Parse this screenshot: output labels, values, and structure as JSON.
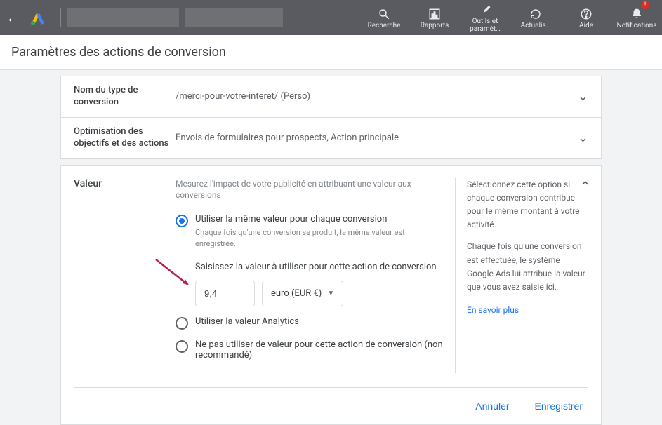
{
  "topbar": {
    "icons": [
      {
        "glyph": "search",
        "label": "Recherche"
      },
      {
        "glyph": "report",
        "label": "Rapports"
      },
      {
        "glyph": "tools",
        "label": "Outils et paramèt…"
      },
      {
        "glyph": "refresh",
        "label": "Actualis…"
      },
      {
        "glyph": "help",
        "label": "Aide"
      },
      {
        "glyph": "bell",
        "label": "Notifications"
      }
    ]
  },
  "page_title": "Paramètres des actions de conversion",
  "settings": {
    "name": {
      "label": "Nom du type de conversion",
      "value": "/merci-pour-votre-interet/ (Perso)"
    },
    "optim": {
      "label": "Optimisation des objectifs et des actions",
      "value": "Envois de formulaires pour prospects, Action principale"
    }
  },
  "valeur": {
    "label": "Valeur",
    "subtitle": "Mesurez l'impact de votre publicité en attribuant une valeur aux conversions",
    "option1": {
      "title": "Utiliser la même valeur pour chaque conversion",
      "desc": "Chaque fois qu'une conversion se produit, la même valeur est enregistrée.",
      "input_label": "Saisissez la valeur à utiliser pour cette action de conversion",
      "value": "9,4",
      "currency": "euro (EUR €)"
    },
    "option2": {
      "title": "Utiliser la valeur Analytics"
    },
    "option3": {
      "title": "Ne pas utiliser de valeur pour cette action de conversion (non recommandé)"
    },
    "help": {
      "p1": "Sélectionnez cette option si chaque conversion contribue pour le même montant à votre activité.",
      "p2": "Chaque fois qu'une conversion est effectuée, le système Google Ads lui attribue la valeur que vous avez saisie ici.",
      "link": "En savoir plus"
    },
    "actions": {
      "cancel": "Annuler",
      "save": "Enregistrer"
    }
  }
}
